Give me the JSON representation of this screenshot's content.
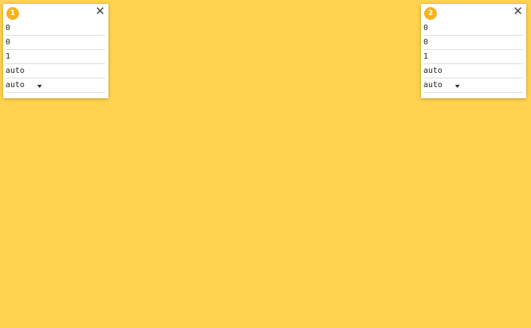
{
  "colors": {
    "background": "#FFD34E",
    "card": "#FFFFFF",
    "badge": "#F7B21B"
  },
  "items": [
    {
      "badge": "1",
      "close_icon": "close-icon",
      "fields": [
        "0",
        "0",
        "1",
        "auto"
      ],
      "select_value": "auto"
    },
    {
      "badge": "2",
      "close_icon": "close-icon",
      "fields": [
        "0",
        "0",
        "1",
        "auto"
      ],
      "select_value": "auto"
    }
  ],
  "close_symbol": "✕"
}
